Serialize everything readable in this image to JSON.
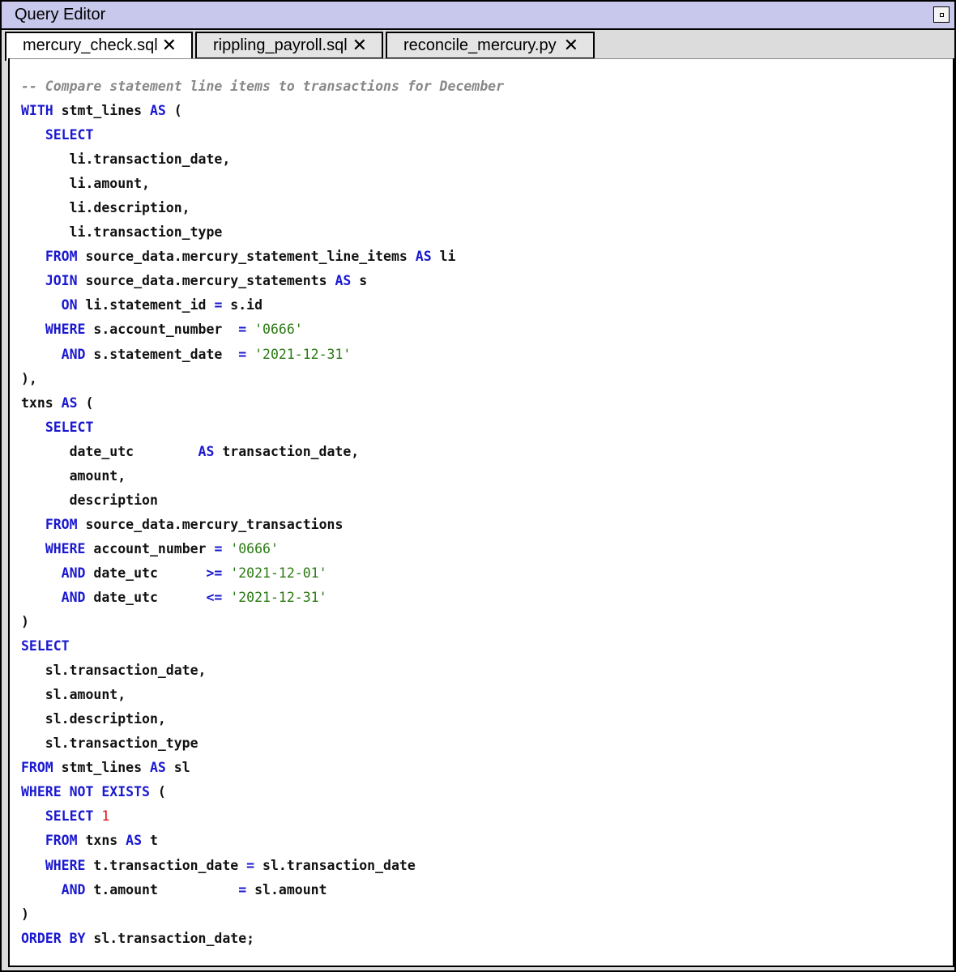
{
  "window": {
    "title": "Query Editor"
  },
  "tabs": [
    {
      "label": "mercury_check.sql",
      "active": true
    },
    {
      "label": "rippling_payroll.sql",
      "active": false
    },
    {
      "label": "reconcile_mercury.py",
      "active": false
    }
  ],
  "icons": {
    "close": "close-icon",
    "zoom": "zoom-box-icon"
  },
  "colors": {
    "keyword": "#1a18d0",
    "string": "#2a7a12",
    "number": "#e01010",
    "comment": "#888888",
    "titlebar": "#c8c8ec"
  },
  "code_lines": [
    [
      {
        "t": "cm",
        "v": "-- Compare statement line items to transactions for December"
      }
    ],
    [
      {
        "t": "kw",
        "v": "WITH"
      },
      {
        "t": "tx",
        "v": " stmt_lines "
      },
      {
        "t": "kw",
        "v": "AS"
      },
      {
        "t": "tx",
        "v": " ("
      }
    ],
    [
      {
        "t": "tx",
        "v": "   "
      },
      {
        "t": "kw",
        "v": "SELECT"
      }
    ],
    [
      {
        "t": "tx",
        "v": "      li.transaction_date,"
      }
    ],
    [
      {
        "t": "tx",
        "v": "      li.amount,"
      }
    ],
    [
      {
        "t": "tx",
        "v": "      li.description,"
      }
    ],
    [
      {
        "t": "tx",
        "v": "      li.transaction_type"
      }
    ],
    [
      {
        "t": "tx",
        "v": "   "
      },
      {
        "t": "kw",
        "v": "FROM"
      },
      {
        "t": "tx",
        "v": " source_data.mercury_statement_line_items "
      },
      {
        "t": "kw",
        "v": "AS"
      },
      {
        "t": "tx",
        "v": " li"
      }
    ],
    [
      {
        "t": "tx",
        "v": "   "
      },
      {
        "t": "kw",
        "v": "JOIN"
      },
      {
        "t": "tx",
        "v": " source_data.mercury_statements "
      },
      {
        "t": "kw",
        "v": "AS"
      },
      {
        "t": "tx",
        "v": " s"
      }
    ],
    [
      {
        "t": "tx",
        "v": "     "
      },
      {
        "t": "kw",
        "v": "ON"
      },
      {
        "t": "tx",
        "v": " li.statement_id "
      },
      {
        "t": "op",
        "v": "="
      },
      {
        "t": "tx",
        "v": " s.id"
      }
    ],
    [
      {
        "t": "tx",
        "v": "   "
      },
      {
        "t": "kw",
        "v": "WHERE"
      },
      {
        "t": "tx",
        "v": " s.account_number  "
      },
      {
        "t": "op",
        "v": "="
      },
      {
        "t": "tx",
        "v": " "
      },
      {
        "t": "str",
        "v": "'0666'"
      }
    ],
    [
      {
        "t": "tx",
        "v": "     "
      },
      {
        "t": "kw",
        "v": "AND"
      },
      {
        "t": "tx",
        "v": " s.statement_date  "
      },
      {
        "t": "op",
        "v": "="
      },
      {
        "t": "tx",
        "v": " "
      },
      {
        "t": "str",
        "v": "'2021-12-31'"
      }
    ],
    [
      {
        "t": "tx",
        "v": "),"
      }
    ],
    [
      {
        "t": "tx",
        "v": "txns "
      },
      {
        "t": "kw",
        "v": "AS"
      },
      {
        "t": "tx",
        "v": " ("
      }
    ],
    [
      {
        "t": "tx",
        "v": "   "
      },
      {
        "t": "kw",
        "v": "SELECT"
      }
    ],
    [
      {
        "t": "tx",
        "v": "      date_utc        "
      },
      {
        "t": "kw",
        "v": "AS"
      },
      {
        "t": "tx",
        "v": " transaction_date,"
      }
    ],
    [
      {
        "t": "tx",
        "v": "      amount,"
      }
    ],
    [
      {
        "t": "tx",
        "v": "      description"
      }
    ],
    [
      {
        "t": "tx",
        "v": "   "
      },
      {
        "t": "kw",
        "v": "FROM"
      },
      {
        "t": "tx",
        "v": " source_data.mercury_transactions"
      }
    ],
    [
      {
        "t": "tx",
        "v": "   "
      },
      {
        "t": "kw",
        "v": "WHERE"
      },
      {
        "t": "tx",
        "v": " account_number "
      },
      {
        "t": "op",
        "v": "="
      },
      {
        "t": "tx",
        "v": " "
      },
      {
        "t": "str",
        "v": "'0666'"
      }
    ],
    [
      {
        "t": "tx",
        "v": "     "
      },
      {
        "t": "kw",
        "v": "AND"
      },
      {
        "t": "tx",
        "v": " date_utc      "
      },
      {
        "t": "op",
        "v": ">="
      },
      {
        "t": "tx",
        "v": " "
      },
      {
        "t": "str",
        "v": "'2021-12-01'"
      }
    ],
    [
      {
        "t": "tx",
        "v": "     "
      },
      {
        "t": "kw",
        "v": "AND"
      },
      {
        "t": "tx",
        "v": " date_utc      "
      },
      {
        "t": "op",
        "v": "<="
      },
      {
        "t": "tx",
        "v": " "
      },
      {
        "t": "str",
        "v": "'2021-12-31'"
      }
    ],
    [
      {
        "t": "tx",
        "v": ")"
      }
    ],
    [
      {
        "t": "kw",
        "v": "SELECT"
      }
    ],
    [
      {
        "t": "tx",
        "v": "   sl.transaction_date,"
      }
    ],
    [
      {
        "t": "tx",
        "v": "   sl.amount,"
      }
    ],
    [
      {
        "t": "tx",
        "v": "   sl.description,"
      }
    ],
    [
      {
        "t": "tx",
        "v": "   sl.transaction_type"
      }
    ],
    [
      {
        "t": "kw",
        "v": "FROM"
      },
      {
        "t": "tx",
        "v": " stmt_lines "
      },
      {
        "t": "kw",
        "v": "AS"
      },
      {
        "t": "tx",
        "v": " sl"
      }
    ],
    [
      {
        "t": "kw",
        "v": "WHERE NOT EXISTS"
      },
      {
        "t": "tx",
        "v": " ("
      }
    ],
    [
      {
        "t": "tx",
        "v": "   "
      },
      {
        "t": "kw",
        "v": "SELECT"
      },
      {
        "t": "tx",
        "v": " "
      },
      {
        "t": "num",
        "v": "1"
      }
    ],
    [
      {
        "t": "tx",
        "v": "   "
      },
      {
        "t": "kw",
        "v": "FROM"
      },
      {
        "t": "tx",
        "v": " txns "
      },
      {
        "t": "kw",
        "v": "AS"
      },
      {
        "t": "tx",
        "v": " t"
      }
    ],
    [
      {
        "t": "tx",
        "v": "   "
      },
      {
        "t": "kw",
        "v": "WHERE"
      },
      {
        "t": "tx",
        "v": " t.transaction_date "
      },
      {
        "t": "op",
        "v": "="
      },
      {
        "t": "tx",
        "v": " sl.transaction_date"
      }
    ],
    [
      {
        "t": "tx",
        "v": "     "
      },
      {
        "t": "kw",
        "v": "AND"
      },
      {
        "t": "tx",
        "v": " t.amount          "
      },
      {
        "t": "op",
        "v": "="
      },
      {
        "t": "tx",
        "v": " sl.amount"
      }
    ],
    [
      {
        "t": "tx",
        "v": ")"
      }
    ],
    [
      {
        "t": "kw",
        "v": "ORDER BY"
      },
      {
        "t": "tx",
        "v": " sl.transaction_date;"
      }
    ]
  ]
}
